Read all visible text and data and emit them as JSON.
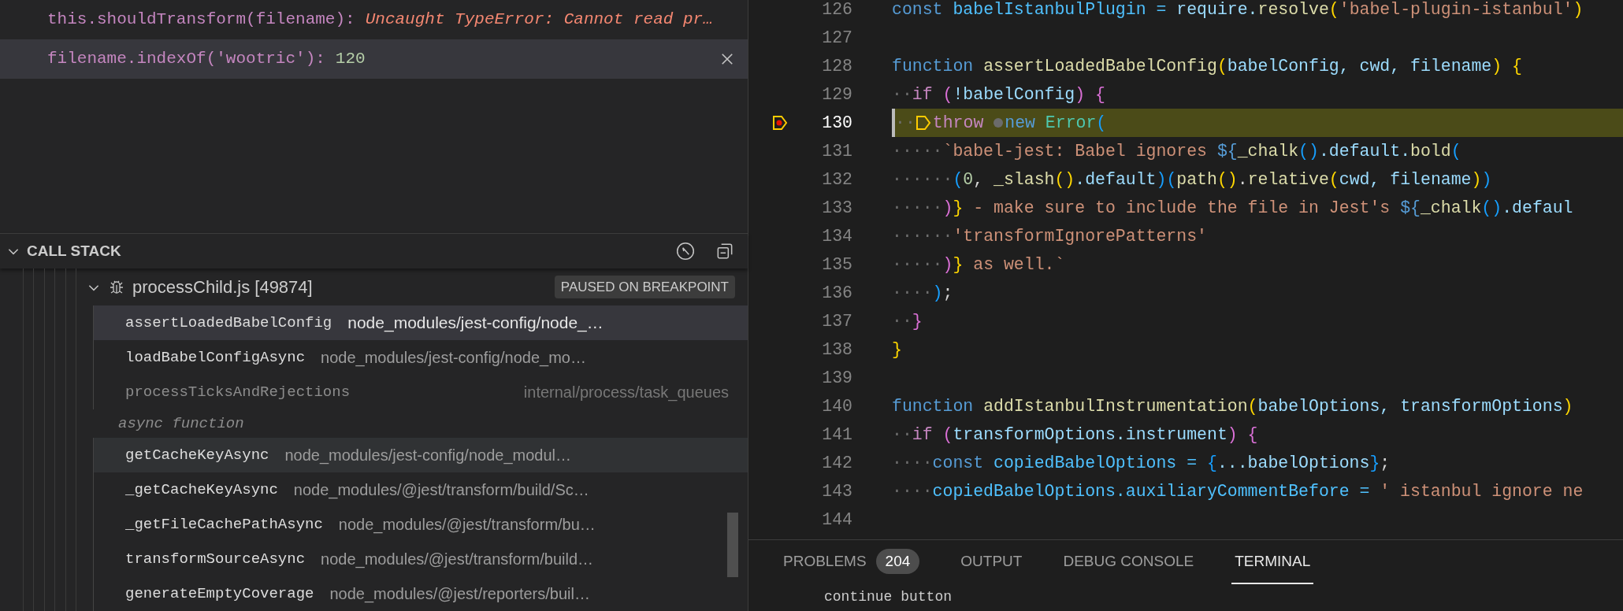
{
  "watch": {
    "items": [
      {
        "expression": "this.shouldTransform(filename):",
        "value": "Uncaught TypeError: Cannot read pr…",
        "kind": "error",
        "selected": false
      },
      {
        "expression": "filename.indexOf('wootric'):",
        "value": "120",
        "kind": "number",
        "selected": true
      }
    ]
  },
  "call_stack": {
    "title": "CALL STACK",
    "expanded": true,
    "thread": {
      "name": "processChild.js [49874]",
      "expanded": true,
      "badge": "PAUSED ON BREAKPOINT"
    },
    "frames": [
      {
        "kind": "frame",
        "name": "assertLoadedBabelConfig",
        "path": "node_modules/jest-config/node_…",
        "selected": true,
        "hovered": false,
        "dimmed": false
      },
      {
        "kind": "frame",
        "name": "loadBabelConfigAsync",
        "path": "node_modules/jest-config/node_mo…",
        "selected": false,
        "hovered": false,
        "dimmed": false
      },
      {
        "kind": "frame",
        "name": "processTicksAndRejections",
        "path": "internal/process/task_queues",
        "selected": false,
        "hovered": false,
        "dimmed": true
      },
      {
        "kind": "label",
        "name": "async function"
      },
      {
        "kind": "frame",
        "name": "getCacheKeyAsync",
        "path": "node_modules/jest-config/node_modul…",
        "selected": false,
        "hovered": true,
        "dimmed": false
      },
      {
        "kind": "frame",
        "name": "_getCacheKeyAsync",
        "path": "node_modules/@jest/transform/build/Sc…",
        "selected": false,
        "hovered": false,
        "dimmed": false
      },
      {
        "kind": "frame",
        "name": "_getFileCachePathAsync",
        "path": "node_modules/@jest/transform/bu…",
        "selected": false,
        "hovered": false,
        "dimmed": false
      },
      {
        "kind": "frame",
        "name": "transformSourceAsync",
        "path": "node_modules/@jest/transform/build…",
        "selected": false,
        "hovered": false,
        "dimmed": false
      },
      {
        "kind": "frame",
        "name": "generateEmptyCoverage",
        "path": "node_modules/@jest/reporters/buil…",
        "selected": false,
        "hovered": false,
        "dimmed": false
      }
    ]
  },
  "editor": {
    "lines": [
      {
        "number": "126",
        "current": false,
        "breakpoint": false,
        "tokens": [
          {
            "text": "const ",
            "kind": "kw"
          },
          {
            "text": "babelIstanbulPlugin = ",
            "kind": "const"
          },
          {
            "text": "require.",
            "kind": "var"
          },
          {
            "text": "resolve",
            "kind": "fn"
          },
          {
            "text": "(",
            "kind": "b1"
          },
          {
            "text": "'babel-plugin-istanbul'",
            "kind": "str"
          },
          {
            "text": ")",
            "kind": "b1"
          }
        ]
      },
      {
        "number": "127",
        "current": false,
        "breakpoint": false
      },
      {
        "number": "128",
        "current": false,
        "breakpoint": false,
        "tokens": [
          {
            "text": "function ",
            "kind": "kw"
          },
          {
            "text": "assertLoadedBabelConfig",
            "kind": "fn"
          },
          {
            "text": "(",
            "kind": "b1"
          },
          {
            "text": "babelConfig, cwd, filename",
            "kind": "var"
          },
          {
            "text": ") {",
            "kind": "b1"
          }
        ]
      },
      {
        "number": "129",
        "current": false,
        "breakpoint": false,
        "tokens": [
          {
            "text": "··",
            "kind": "ws"
          },
          {
            "text": "if ",
            "kind": "ctl"
          },
          {
            "text": "(",
            "kind": "b2"
          },
          {
            "text": "!babelConfig",
            "kind": "var"
          },
          {
            "text": ") {",
            "kind": "b2"
          }
        ]
      },
      {
        "number": "130",
        "current": true,
        "breakpoint": true,
        "tokens": [
          {
            "text": "··",
            "kind": "ws"
          },
          {
            "kind": "arrow"
          },
          {
            "text": "throw ",
            "kind": "ctl"
          },
          {
            "kind": "dot"
          },
          {
            "text": "new ",
            "kind": "kw"
          },
          {
            "text": "Error",
            "kind": "cls"
          },
          {
            "text": "(",
            "kind": "b3"
          }
        ]
      },
      {
        "number": "131",
        "current": false,
        "breakpoint": false,
        "tokens": [
          {
            "text": "·····",
            "kind": "ws"
          },
          {
            "text": "`babel-jest: Babel ignores ",
            "kind": "str"
          },
          {
            "text": "${",
            "kind": "kw"
          },
          {
            "text": "_chalk",
            "kind": "fn"
          },
          {
            "text": "()",
            "kind": "b3"
          },
          {
            "text": ".default.",
            "kind": "var"
          },
          {
            "text": "bold",
            "kind": "fn"
          },
          {
            "text": "(",
            "kind": "b3"
          }
        ]
      },
      {
        "number": "132",
        "current": false,
        "breakpoint": false,
        "tokens": [
          {
            "text": "······",
            "kind": "ws"
          },
          {
            "text": "(",
            "kind": "b3"
          },
          {
            "text": "0",
            "kind": "num"
          },
          {
            "text": ",",
            "kind": "p"
          },
          {
            "text": " _slash",
            "kind": "fn"
          },
          {
            "text": "()",
            "kind": "b1"
          },
          {
            "text": ".default",
            "kind": "var"
          },
          {
            "text": ")(",
            "kind": "b3"
          },
          {
            "text": "path",
            "kind": "fn"
          },
          {
            "text": "()",
            "kind": "b1"
          },
          {
            "text": ".",
            "kind": "p"
          },
          {
            "text": "relative",
            "kind": "fn"
          },
          {
            "text": "(",
            "kind": "b1"
          },
          {
            "text": "cwd, filename",
            "kind": "var"
          },
          {
            "text": ")",
            "kind": "b1"
          },
          {
            "text": ")",
            "kind": "b3"
          }
        ]
      },
      {
        "number": "133",
        "current": false,
        "breakpoint": false,
        "tokens": [
          {
            "text": "·····",
            "kind": "ws"
          },
          {
            "text": ")",
            "kind": "b2"
          },
          {
            "text": "}",
            "kind": "b1"
          },
          {
            "text": " - make sure to include the file in Jest's ",
            "kind": "str"
          },
          {
            "text": "${",
            "kind": "kw"
          },
          {
            "text": "_chalk",
            "kind": "fn"
          },
          {
            "text": "()",
            "kind": "b3"
          },
          {
            "text": ".defaul",
            "kind": "var"
          }
        ]
      },
      {
        "number": "134",
        "current": false,
        "breakpoint": false,
        "tokens": [
          {
            "text": "······",
            "kind": "ws"
          },
          {
            "text": "'transformIgnorePatterns'",
            "kind": "str"
          }
        ]
      },
      {
        "number": "135",
        "current": false,
        "breakpoint": false,
        "tokens": [
          {
            "text": "·····",
            "kind": "ws"
          },
          {
            "text": ")",
            "kind": "b2"
          },
          {
            "text": "}",
            "kind": "b1"
          },
          {
            "text": " as well.`",
            "kind": "str"
          }
        ]
      },
      {
        "number": "136",
        "current": false,
        "breakpoint": false,
        "tokens": [
          {
            "text": "····",
            "kind": "ws"
          },
          {
            "text": ")",
            "kind": "b3"
          },
          {
            "text": ";",
            "kind": "p"
          }
        ]
      },
      {
        "number": "137",
        "current": false,
        "breakpoint": false,
        "tokens": [
          {
            "text": "··",
            "kind": "ws"
          },
          {
            "text": "}",
            "kind": "b2"
          }
        ]
      },
      {
        "number": "138",
        "current": false,
        "breakpoint": false,
        "tokens": [
          {
            "text": "}",
            "kind": "b1"
          }
        ]
      },
      {
        "number": "139",
        "current": false,
        "breakpoint": false
      },
      {
        "number": "140",
        "current": false,
        "breakpoint": false,
        "tokens": [
          {
            "text": "function ",
            "kind": "kw"
          },
          {
            "text": "addIstanbulInstrumentation",
            "kind": "fn"
          },
          {
            "text": "(",
            "kind": "b1"
          },
          {
            "text": "babelOptions, transformOptions",
            "kind": "var"
          },
          {
            "text": ")",
            "kind": "b1"
          }
        ]
      },
      {
        "number": "141",
        "current": false,
        "breakpoint": false,
        "tokens": [
          {
            "text": "··",
            "kind": "ws"
          },
          {
            "text": "if ",
            "kind": "ctl"
          },
          {
            "text": "(",
            "kind": "b2"
          },
          {
            "text": "transformOptions.instrument",
            "kind": "var"
          },
          {
            "text": ") {",
            "kind": "b2"
          }
        ]
      },
      {
        "number": "142",
        "current": false,
        "breakpoint": false,
        "tokens": [
          {
            "text": "····",
            "kind": "ws"
          },
          {
            "text": "const ",
            "kind": "kw"
          },
          {
            "text": "copiedBabelOptions = ",
            "kind": "const"
          },
          {
            "text": "{",
            "kind": "b3"
          },
          {
            "text": "...babelOptions",
            "kind": "var"
          },
          {
            "text": "}",
            "kind": "b3"
          },
          {
            "text": ";",
            "kind": "p"
          }
        ]
      },
      {
        "number": "143",
        "current": false,
        "breakpoint": false,
        "tokens": [
          {
            "text": "····",
            "kind": "ws"
          },
          {
            "text": "copiedBabelOptions.auxiliaryCommentBefore = ",
            "kind": "const"
          },
          {
            "text": "' istanbul ignore ne",
            "kind": "str"
          }
        ]
      },
      {
        "number": "144",
        "current": false,
        "breakpoint": false
      }
    ]
  },
  "panel": {
    "tabs": [
      {
        "label": "PROBLEMS",
        "count": "204",
        "selected": false
      },
      {
        "label": "OUTPUT",
        "selected": false
      },
      {
        "label": "DEBUG CONSOLE",
        "selected": false
      },
      {
        "label": "TERMINAL",
        "selected": true
      }
    ],
    "terminal_text": "continue button"
  }
}
